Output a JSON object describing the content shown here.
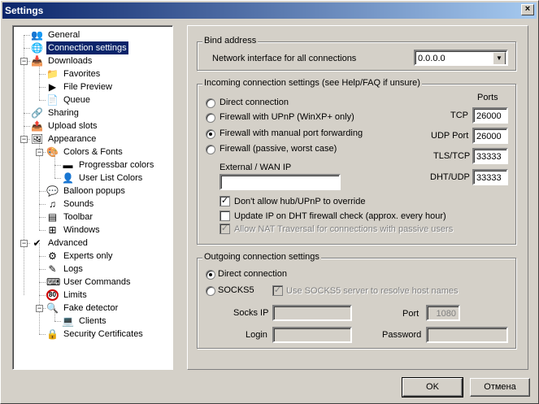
{
  "window": {
    "title": "Settings",
    "close_glyph": "×"
  },
  "tree": {
    "items": [
      {
        "label": "General",
        "icon": "general-icon",
        "glyph": "👥"
      },
      {
        "label": "Connection settings",
        "icon": "connection-icon",
        "glyph": "🌐",
        "selected": true
      },
      {
        "label": "Downloads",
        "icon": "downloads-icon",
        "glyph": "📥"
      },
      {
        "label": "Favorites",
        "icon": "favorites-icon",
        "glyph": "📁"
      },
      {
        "label": "File Preview",
        "icon": "file-preview-icon",
        "glyph": "▶"
      },
      {
        "label": "Queue",
        "icon": "queue-icon",
        "glyph": "📄"
      },
      {
        "label": "Sharing",
        "icon": "sharing-icon",
        "glyph": "🔗"
      },
      {
        "label": "Upload slots",
        "icon": "upload-slots-icon",
        "glyph": "📤"
      },
      {
        "label": "Appearance",
        "icon": "appearance-icon",
        "glyph": "🖼"
      },
      {
        "label": "Colors & Fonts",
        "icon": "colors-fonts-icon",
        "glyph": "🎨"
      },
      {
        "label": "Progressbar colors",
        "icon": "progressbar-icon",
        "glyph": "▬"
      },
      {
        "label": "User List Colors",
        "icon": "user-list-icon",
        "glyph": "👤"
      },
      {
        "label": "Balloon popups",
        "icon": "balloon-icon",
        "glyph": "💬"
      },
      {
        "label": "Sounds",
        "icon": "sounds-icon",
        "glyph": "♫"
      },
      {
        "label": "Toolbar",
        "icon": "toolbar-icon",
        "glyph": "▤"
      },
      {
        "label": "Windows",
        "icon": "windows-icon",
        "glyph": "⊞"
      },
      {
        "label": "Advanced",
        "icon": "advanced-icon",
        "glyph": "✔"
      },
      {
        "label": "Experts only",
        "icon": "experts-icon",
        "glyph": "⚙"
      },
      {
        "label": "Logs",
        "icon": "logs-icon",
        "glyph": "✎"
      },
      {
        "label": "User Commands",
        "icon": "user-commands-icon",
        "glyph": "⌨"
      },
      {
        "label": "Limits",
        "icon": "limits-icon",
        "glyph": "80"
      },
      {
        "label": "Fake detector",
        "icon": "fake-detector-icon",
        "glyph": "🔍"
      },
      {
        "label": "Clients",
        "icon": "clients-icon",
        "glyph": "💻"
      },
      {
        "label": "Security Certificates",
        "icon": "security-icon",
        "glyph": "🔒"
      }
    ],
    "expander_minus": "−"
  },
  "bind": {
    "title": "Bind address",
    "label": "Network interface for all connections",
    "value": "0.0.0.0",
    "arrow": "▼"
  },
  "incoming": {
    "title": "Incoming connection settings (see Help/FAQ if unsure)",
    "options": [
      {
        "label": "Direct connection",
        "selected": false
      },
      {
        "label": "Firewall with UPnP (WinXP+ only)",
        "selected": false
      },
      {
        "label": "Firewall with manual port forwarding",
        "selected": true
      },
      {
        "label": "Firewall (passive, worst case)",
        "selected": false
      }
    ],
    "ports_title": "Ports",
    "tcp_label": "TCP",
    "tcp_value": "26000",
    "udp_label": "UDP Port",
    "udp_value": "26000",
    "tls_label": "TLS/TCP",
    "tls_value": "33333",
    "dht_label": "DHT/UDP",
    "dht_value": "33333",
    "wan_label": "External / WAN IP",
    "wan_value": "",
    "check_mark": "✓",
    "chk_override": "Don't allow hub/UPnP to override",
    "chk_update": "Update IP on DHT firewall check (approx. every hour)",
    "chk_nat": "Allow NAT Traversal for connections with passive users"
  },
  "outgoing": {
    "title": "Outgoing connection settings",
    "direct": "Direct connection",
    "socks": "SOCKS5",
    "use_socks_dns": "Use SOCKS5 server to resolve host names",
    "socks_ip_label": "Socks IP",
    "socks_ip_value": "",
    "port_label": "Port",
    "port_value": "1080",
    "login_label": "Login",
    "login_value": "",
    "password_label": "Password",
    "password_value": ""
  },
  "buttons": {
    "ok": "OK",
    "cancel": "Отмена"
  }
}
